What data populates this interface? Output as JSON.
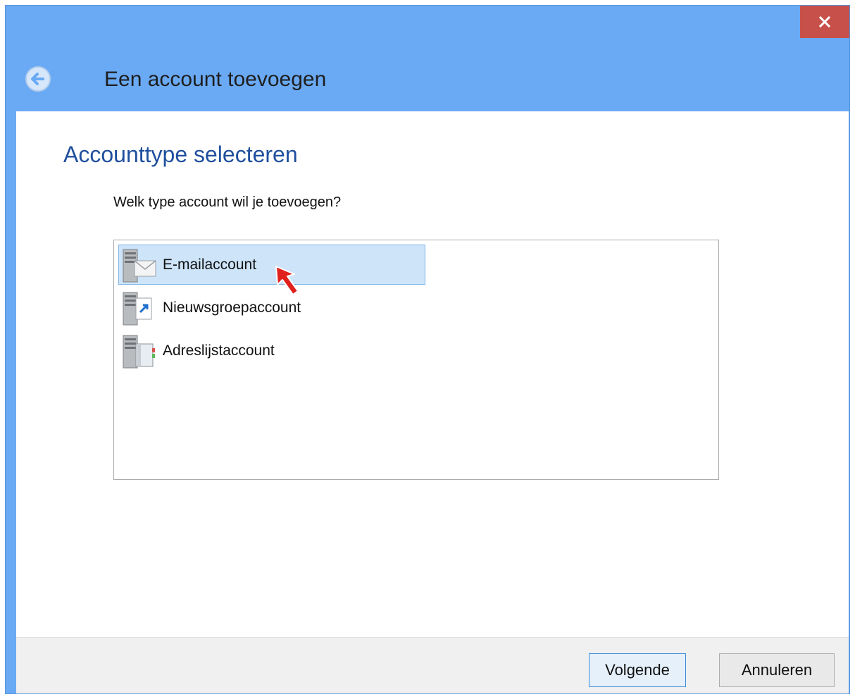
{
  "window": {
    "title": "Een account toevoegen",
    "close_icon": "close-icon",
    "back_icon": "back-arrow-icon"
  },
  "content": {
    "heading": "Accounttype selecteren",
    "question": "Welk type account wil je toevoegen?",
    "account_types": [
      {
        "label": "E-mailaccount",
        "icon": "email-server-icon",
        "selected": true
      },
      {
        "label": "Nieuwsgroepaccount",
        "icon": "newsgroup-server-icon",
        "selected": false
      },
      {
        "label": "Adreslijstaccount",
        "icon": "address-book-server-icon",
        "selected": false
      }
    ]
  },
  "footer": {
    "next_label": "Volgende",
    "cancel_label": "Annuleren"
  },
  "colors": {
    "titlebar": "#6aaaf4",
    "close_button": "#c7504a",
    "heading": "#1f4f9e",
    "selection": "#cde4f9",
    "cursor": "#e0201c"
  }
}
